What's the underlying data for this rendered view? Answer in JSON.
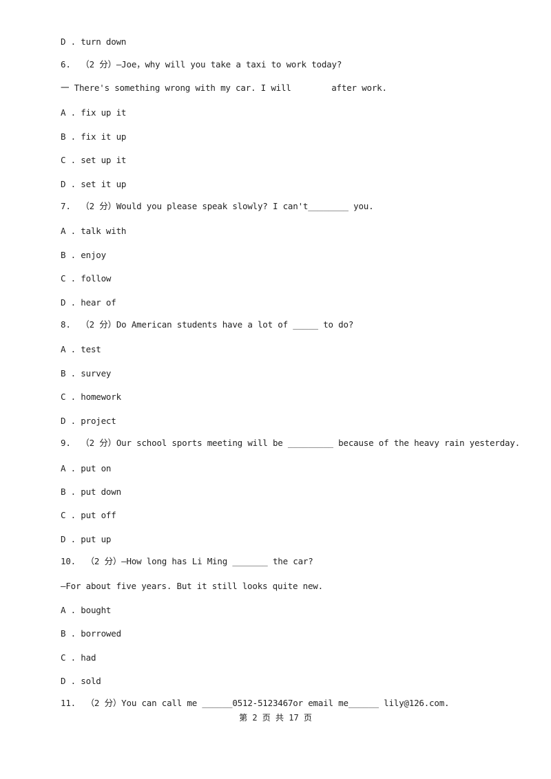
{
  "lines": [
    {
      "type": "option",
      "text": "D . turn down"
    },
    {
      "type": "question",
      "text": "6.  （2 分）—Joe，why will you take a taxi to work today?"
    },
    {
      "type": "question-cont",
      "text": "一 There's something wrong with my car. I will        after work."
    },
    {
      "type": "option",
      "text": "A . fix up it"
    },
    {
      "type": "option",
      "text": "B . fix it up"
    },
    {
      "type": "option",
      "text": "C . set up it"
    },
    {
      "type": "option",
      "text": "D . set it up"
    },
    {
      "type": "question",
      "text": "7.  （2 分）Would you please speak slowly? I can't________ you."
    },
    {
      "type": "option",
      "text": "A . talk with"
    },
    {
      "type": "option",
      "text": "B . enjoy"
    },
    {
      "type": "option",
      "text": "C . follow"
    },
    {
      "type": "option",
      "text": "D . hear of"
    },
    {
      "type": "question",
      "text": "8.  （2 分）Do American students have a lot of _____ to do?"
    },
    {
      "type": "option",
      "text": "A . test"
    },
    {
      "type": "option",
      "text": "B . survey"
    },
    {
      "type": "option",
      "text": "C . homework"
    },
    {
      "type": "option",
      "text": "D . project"
    },
    {
      "type": "question",
      "text": "9.  （2 分）Our school sports meeting will be _________ because of the heavy rain yesterday."
    },
    {
      "type": "option",
      "text": "A . put on"
    },
    {
      "type": "option",
      "text": "B . put down"
    },
    {
      "type": "option",
      "text": "C . put off"
    },
    {
      "type": "option",
      "text": "D . put up"
    },
    {
      "type": "question",
      "text": "10.  （2 分）—How long has Li Ming _______ the car?"
    },
    {
      "type": "question-cont",
      "text": "—For about five years. But it still looks quite new."
    },
    {
      "type": "option",
      "text": "A . bought"
    },
    {
      "type": "option",
      "text": "B . borrowed"
    },
    {
      "type": "option",
      "text": "C . had"
    },
    {
      "type": "option",
      "text": "D . sold"
    },
    {
      "type": "question",
      "text": "11.  （2 分）You can call me ______0512-5123467or email me______ lily@126.com."
    }
  ],
  "footer": "第 2 页 共 17 页"
}
